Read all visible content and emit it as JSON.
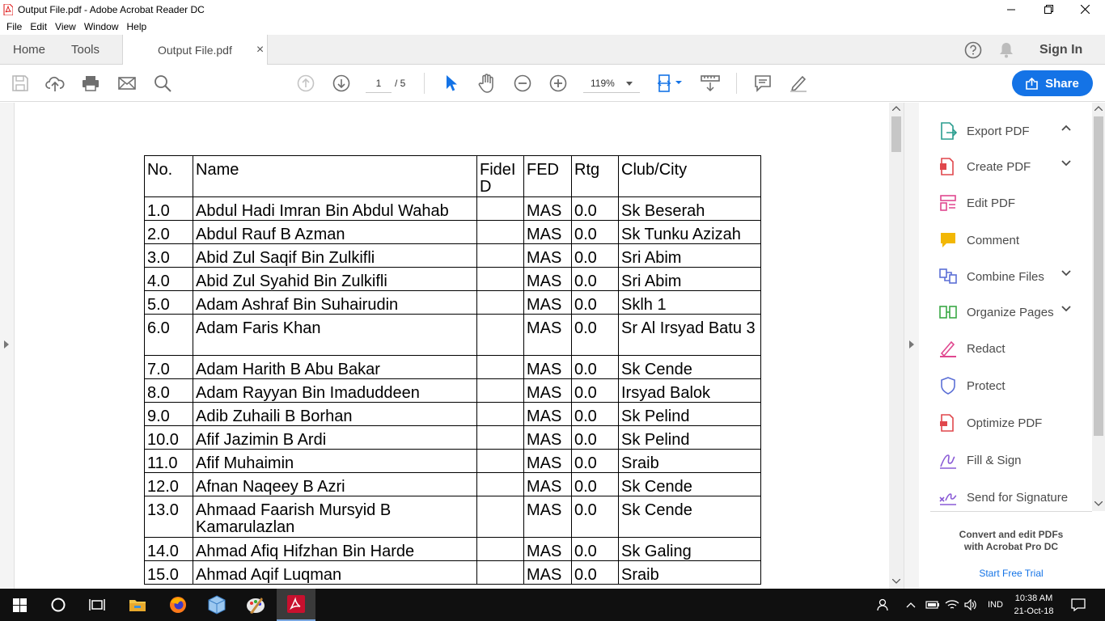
{
  "window": {
    "title": "Output File.pdf - Adobe Acrobat Reader DC"
  },
  "menu": [
    "File",
    "Edit",
    "View",
    "Window",
    "Help"
  ],
  "tabs": {
    "home": "Home",
    "tools": "Tools",
    "document": "Output File.pdf",
    "close": "×"
  },
  "header": {
    "sign_in": "Sign In"
  },
  "toolbar": {
    "page_current": "1",
    "page_total": "/ 5",
    "zoom": "119%",
    "share": "Share"
  },
  "table": {
    "headers": [
      "No.",
      "Name",
      "FideID",
      "FED",
      "Rtg",
      "Club/City"
    ],
    "rows": [
      [
        "1.0",
        "Abdul Hadi Imran Bin Abdul Wahab",
        "",
        "MAS",
        "0.0",
        "Sk Beserah"
      ],
      [
        "2.0",
        "Abdul Rauf B Azman",
        "",
        "MAS",
        "0.0",
        "Sk Tunku Azizah"
      ],
      [
        "3.0",
        "Abid Zul Saqif Bin Zulkifli",
        "",
        "MAS",
        "0.0",
        "Sri Abim"
      ],
      [
        "4.0",
        "Abid Zul Syahid Bin Zulkifli",
        "",
        "MAS",
        "0.0",
        "Sri Abim"
      ],
      [
        "5.0",
        "Adam Ashraf Bin Suhairudin",
        "",
        "MAS",
        "0.0",
        "Sklh 1"
      ],
      [
        "6.0",
        "Adam Faris Khan",
        "",
        "MAS",
        "0.0",
        "Sr Al Irsyad Batu 3"
      ],
      [
        "7.0",
        "Adam Harith B Abu Bakar",
        "",
        "MAS",
        "0.0",
        "Sk Cende"
      ],
      [
        "8.0",
        "Adam Rayyan Bin Imaduddeen",
        "",
        "MAS",
        "0.0",
        "Irsyad Balok"
      ],
      [
        "9.0",
        "Adib Zuhaili B Borhan",
        "",
        "MAS",
        "0.0",
        "Sk Pelind"
      ],
      [
        "10.0",
        "Afif Jazimin B Ardi",
        "",
        "MAS",
        "0.0",
        "Sk Pelind"
      ],
      [
        "11.0",
        "Afif Muhaimin",
        "",
        "MAS",
        "0.0",
        "Sraib"
      ],
      [
        "12.0",
        "Afnan Naqeey B Azri",
        "",
        "MAS",
        "0.0",
        "Sk Cende"
      ],
      [
        "13.0",
        "Ahmaad Faarish Mursyid B Kamarulazlan",
        "",
        "MAS",
        "0.0",
        "Sk Cende"
      ],
      [
        "14.0",
        "Ahmad Afiq Hifzhan Bin Harde",
        "",
        "MAS",
        "0.0",
        "Sk Galing"
      ],
      [
        "15.0",
        "Ahmad Aqif Luqman",
        "",
        "MAS",
        "0.0",
        "Sraib"
      ]
    ]
  },
  "tools_pane": {
    "items": [
      {
        "label": "Export PDF",
        "chevron": "up",
        "color": "#2a9d8f"
      },
      {
        "label": "Create PDF",
        "chevron": "down",
        "color": "#e0474c"
      },
      {
        "label": "Edit PDF",
        "chevron": "",
        "color": "#e0478f"
      },
      {
        "label": "Comment",
        "chevron": "",
        "color": "#f2b705"
      },
      {
        "label": "Combine Files",
        "chevron": "down",
        "color": "#5b6fd6"
      },
      {
        "label": "Organize Pages",
        "chevron": "down",
        "color": "#3aa845"
      },
      {
        "label": "Redact",
        "chevron": "",
        "color": "#e0478f"
      },
      {
        "label": "Protect",
        "chevron": "",
        "color": "#5b6fd6"
      },
      {
        "label": "Optimize PDF",
        "chevron": "",
        "color": "#e0474c"
      },
      {
        "label": "Fill & Sign",
        "chevron": "",
        "color": "#8a5bd6"
      },
      {
        "label": "Send for Signature",
        "chevron": "",
        "color": "#8a5bd6"
      }
    ],
    "promo_line1": "Convert and edit PDFs",
    "promo_line2": "with Acrobat Pro DC",
    "promo_link": "Start Free Trial"
  },
  "taskbar": {
    "lang": "IND",
    "time": "10:38 AM",
    "date": "21-Oct-18"
  }
}
